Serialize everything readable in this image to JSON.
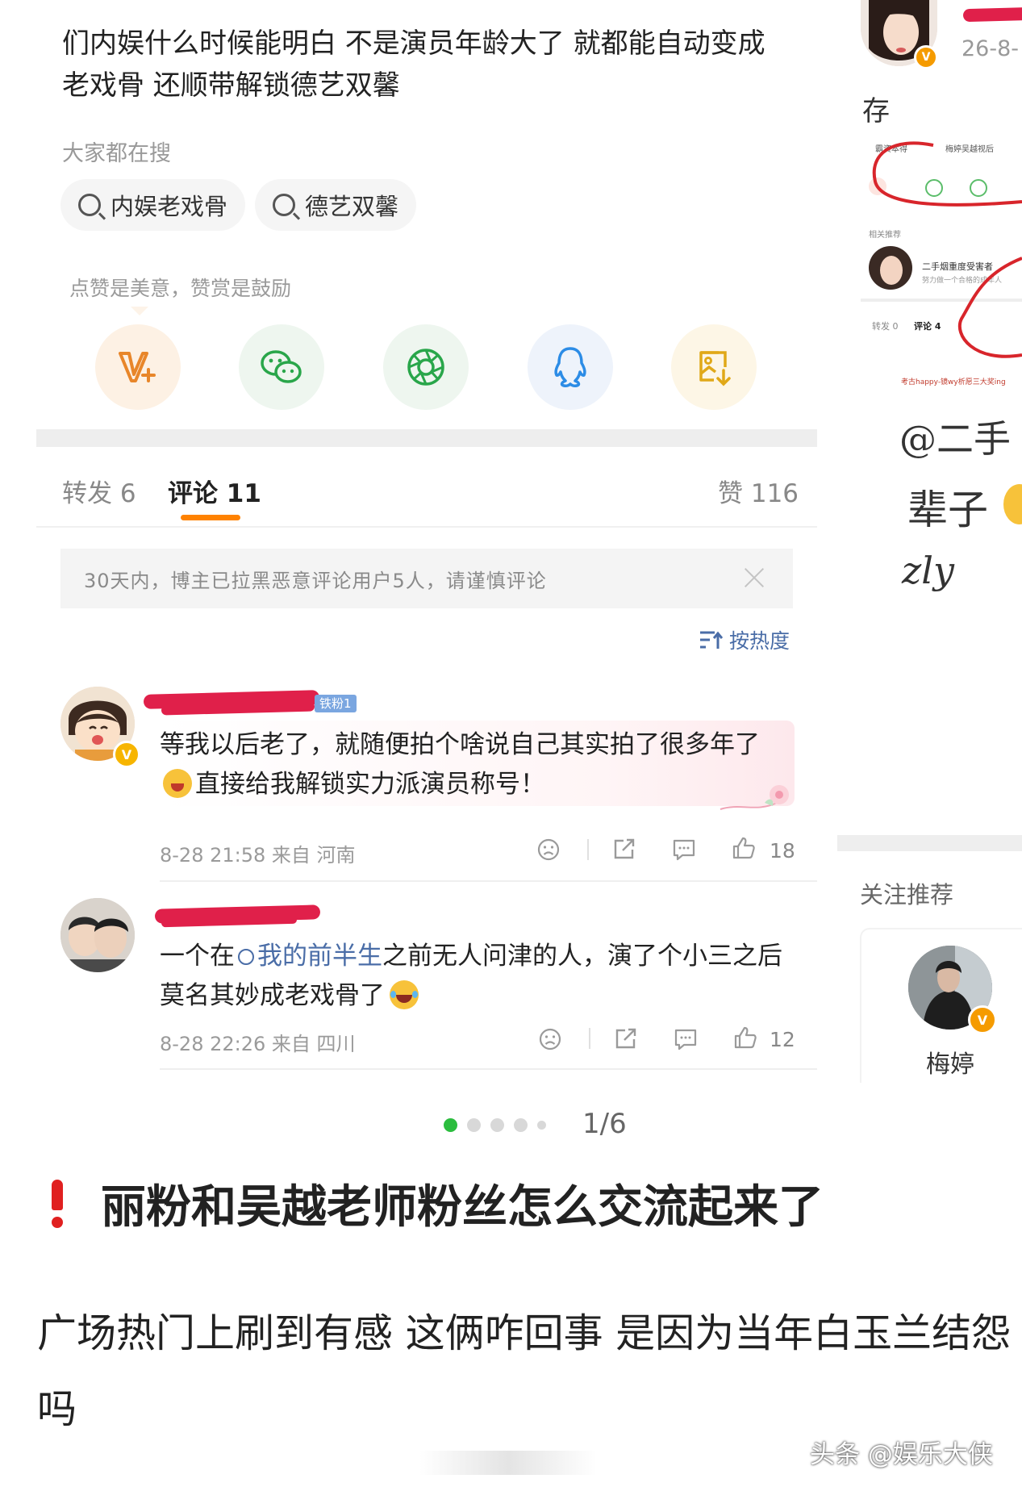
{
  "post": {
    "text": "们内娱什么时候能明白 不是演员年龄大了 就都能自动变成老戏骨 还顺带解锁德艺双馨"
  },
  "search": {
    "title": "大家都在搜",
    "chips": [
      "内娱老戏骨",
      "德艺双馨"
    ]
  },
  "reward_tip": "点赞是美意，赞赏是鼓励",
  "share_icons": [
    "reward-icon",
    "wechat-icon",
    "moments-icon",
    "qq-icon",
    "save-image-icon"
  ],
  "tabs": {
    "repost": "转发 6",
    "comments": "评论 11",
    "likes": "赞 116"
  },
  "notice": "30天内，博主已拉黑恶意评论用户5人，请谨慎评论",
  "sort_label": "按热度",
  "comments": [
    {
      "text_a": "等我以后老了，就随便拍个啥说自己其实拍了很多年了",
      "text_b": "直接给我解锁实力派演员称号！",
      "meta": "8-28 21:58 来自 河南",
      "likes": "18",
      "fan_badge": "铁粉1"
    },
    {
      "text_a": "一个在",
      "link": "我的前半生",
      "text_b": "之前无人问津的人，演了个小三之后莫名其妙成老戏骨了",
      "meta": "8-28 22:26 来自 四川",
      "likes": "12"
    }
  ],
  "pager": {
    "label": "1/6",
    "total_dots": 5,
    "active_dot": 0
  },
  "headline": "丽粉和吴越老师粉丝怎么交流起来了",
  "body": "广场热门上刷到有感 这俩咋回事 是因为当年白玉兰结怨吗",
  "watermark": "头条 @娱乐大侠",
  "right_panel": {
    "date": "26-8-",
    "save_label": "存",
    "mini_search_1": "霸资本得",
    "mini_search_2": "梅婷吴越视后",
    "mini_related": "相关推荐",
    "mini_user": "二手烟重度受害者",
    "mini_user_sub": "努力做一个合格的成年人",
    "mini_repost": "转发 0",
    "mini_comment": "评论 4",
    "mini_footer": "考古happy-镜wy析愿三大奖ing",
    "hand_1": "@二手",
    "hand_2": "辈子",
    "hand_3": "zly",
    "follow_title": "关注推荐",
    "follow_name": "梅婷"
  },
  "colors": {
    "accent_orange": "#ff8200",
    "link_blue": "#4a6da7",
    "alert_red": "#e02020",
    "redact_red": "#e0204a",
    "active_dot": "#2bbd3e"
  }
}
